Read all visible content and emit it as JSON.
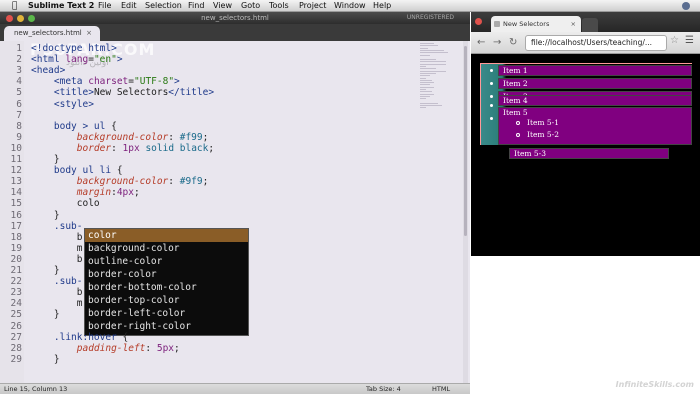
{
  "menubar": {
    "apple": "",
    "app_name": "Sublime Text 2",
    "items": [
      "File",
      "Edit",
      "Selection",
      "Find",
      "View",
      "Goto",
      "Tools",
      "Project",
      "Window",
      "Help"
    ]
  },
  "editor": {
    "window_title": "new_selectors.html",
    "unregistered": "UNREGISTERED",
    "tab_label": "new_selectors.html",
    "tab_close": "×",
    "watermark": "P30FAR.COM",
    "watermark_sub": "اولین دانلود",
    "line_numbers": [
      "1",
      "2",
      "3",
      "4",
      "5",
      "6",
      "7",
      "8",
      "9",
      "10",
      "11",
      "12",
      "13",
      "14",
      "15",
      "16",
      "17",
      "18",
      "19",
      "20",
      "21",
      "22",
      "23",
      "24",
      "25",
      "26",
      "27",
      "28",
      "29"
    ],
    "lines": [
      {
        "segs": [
          [
            "t-tag",
            "<!doctype html>"
          ]
        ]
      },
      {
        "segs": [
          [
            "t-tag",
            "<html "
          ],
          [
            "t-attr",
            "lang"
          ],
          [
            "",
            "="
          ],
          [
            "t-str",
            "\"en\""
          ],
          [
            "t-tag",
            ">"
          ]
        ]
      },
      {
        "segs": [
          [
            "t-tag",
            "<head>"
          ]
        ]
      },
      {
        "segs": [
          [
            "",
            "    "
          ],
          [
            "t-tag",
            "<meta "
          ],
          [
            "t-attr",
            "charset"
          ],
          [
            "",
            "="
          ],
          [
            "t-str",
            "\"UTF-8\""
          ],
          [
            "t-tag",
            ">"
          ]
        ]
      },
      {
        "segs": [
          [
            "",
            "    "
          ],
          [
            "t-tag",
            "<title>"
          ],
          [
            "",
            "New Selectors"
          ],
          [
            "t-tag",
            "</title>"
          ]
        ]
      },
      {
        "segs": [
          [
            "",
            "    "
          ],
          [
            "t-tag",
            "<style>"
          ]
        ]
      },
      {
        "segs": [
          [
            "",
            ""
          ]
        ]
      },
      {
        "segs": [
          [
            "",
            "    "
          ],
          [
            "t-sel",
            "body > ul"
          ],
          [
            "",
            " {"
          ]
        ]
      },
      {
        "segs": [
          [
            "",
            "        "
          ],
          [
            "t-prop",
            "background-color"
          ],
          [
            "",
            ": "
          ],
          [
            "t-val",
            "#f99"
          ],
          [
            "",
            ";"
          ]
        ]
      },
      {
        "segs": [
          [
            "",
            "        "
          ],
          [
            "t-prop",
            "border"
          ],
          [
            "",
            ": "
          ],
          [
            "t-num",
            "1px"
          ],
          [
            "t-val",
            " solid black"
          ],
          [
            "",
            ";"
          ]
        ]
      },
      {
        "segs": [
          [
            "",
            "    }"
          ]
        ]
      },
      {
        "segs": [
          [
            "",
            "    "
          ],
          [
            "t-sel",
            "body ul li"
          ],
          [
            "",
            " {"
          ]
        ]
      },
      {
        "segs": [
          [
            "",
            "        "
          ],
          [
            "t-prop",
            "background-color"
          ],
          [
            "",
            ": "
          ],
          [
            "t-val",
            "#9f9"
          ],
          [
            "",
            ";"
          ]
        ]
      },
      {
        "segs": [
          [
            "",
            "        "
          ],
          [
            "t-prop",
            "margin"
          ],
          [
            "",
            ":"
          ],
          [
            "t-num",
            "4px"
          ],
          [
            "",
            ";"
          ]
        ]
      },
      {
        "segs": [
          [
            "",
            "        colo"
          ]
        ]
      },
      {
        "segs": [
          [
            "",
            "    }"
          ]
        ]
      },
      {
        "segs": [
          [
            "",
            "    "
          ],
          [
            "t-sel",
            ".sub-"
          ]
        ]
      },
      {
        "segs": [
          [
            "",
            "        b"
          ]
        ]
      },
      {
        "segs": [
          [
            "",
            "        m"
          ]
        ]
      },
      {
        "segs": [
          [
            "",
            "        b"
          ]
        ]
      },
      {
        "segs": [
          [
            "",
            "    }"
          ]
        ]
      },
      {
        "segs": [
          [
            "",
            "    "
          ],
          [
            "t-sel",
            ".sub-"
          ]
        ]
      },
      {
        "segs": [
          [
            "",
            "        b"
          ]
        ]
      },
      {
        "segs": [
          [
            "",
            "        m"
          ]
        ]
      },
      {
        "segs": [
          [
            "",
            "    }"
          ]
        ]
      },
      {
        "segs": [
          [
            "",
            ""
          ]
        ]
      },
      {
        "segs": [
          [
            "",
            "    "
          ],
          [
            "t-sel",
            ".link:hover"
          ],
          [
            "",
            " {"
          ]
        ]
      },
      {
        "segs": [
          [
            "",
            "        "
          ],
          [
            "t-prop",
            "padding-left"
          ],
          [
            "",
            ": "
          ],
          [
            "t-num",
            "5px"
          ],
          [
            "",
            ";"
          ]
        ]
      },
      {
        "segs": [
          [
            "",
            "    }"
          ]
        ]
      }
    ],
    "autocomplete": [
      {
        "label": "color",
        "selected": true
      },
      {
        "label": "background-color",
        "selected": false
      },
      {
        "label": "outline-color",
        "selected": false
      },
      {
        "label": "border-color",
        "selected": false
      },
      {
        "label": "border-bottom-color",
        "selected": false
      },
      {
        "label": "border-top-color",
        "selected": false
      },
      {
        "label": "border-left-color",
        "selected": false
      },
      {
        "label": "border-right-color",
        "selected": false
      }
    ],
    "status": {
      "position": "Line 15, Column 13",
      "tab_size": "Tab Size: 4",
      "syntax": "HTML"
    }
  },
  "browser": {
    "tab_title": "New Selectors",
    "tab_close": "×",
    "url": "file://localhost/Users/teaching/...",
    "list_items": [
      "Item 1",
      "Item 2",
      "Item 3",
      "Item 4",
      "Item 5"
    ],
    "sub_items": [
      "Item 5-1",
      "Item 5-2",
      "Item 5-3"
    ]
  },
  "brand": "InfiniteSkills.com",
  "colors": {
    "list_bg": "#ff9999",
    "item_bg": "#800080",
    "autocomplete_selected": "#8a5d27"
  }
}
